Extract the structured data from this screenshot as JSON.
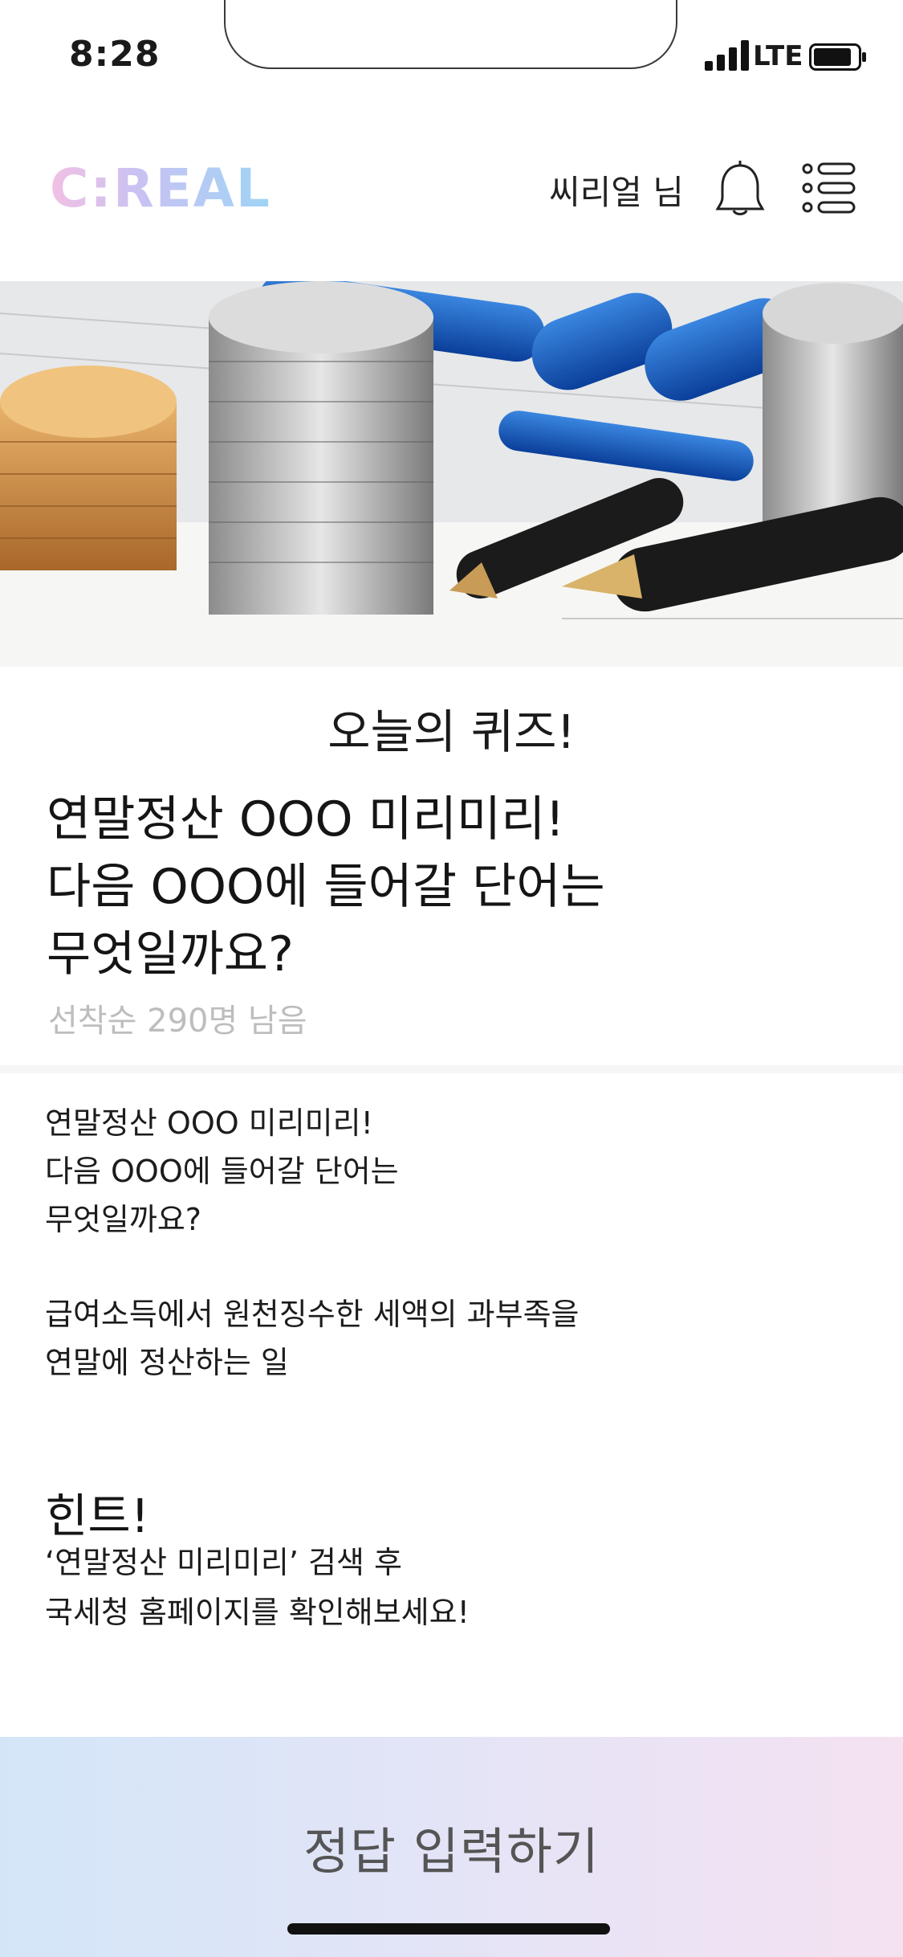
{
  "status_bar": {
    "time": "8:28",
    "network": "LTE",
    "battery_level": 0.8
  },
  "header": {
    "logo": "C:REAL",
    "user_name": "씨리얼 님",
    "bell_icon": "bell-icon",
    "menu_icon": "menu-list-icon"
  },
  "hero": {
    "image": "coins-and-pens-photo"
  },
  "quiz": {
    "label": "오늘의 퀴즈!",
    "question_lines": [
      "연말정산 OOO 미리미리!",
      "다음 OOO에 들어갈 단어는",
      "무엇일까요?"
    ],
    "remaining": "선착순 290명 남음"
  },
  "body": {
    "lines": [
      "연말정산 OOO 미리미리!",
      "다음 OOO에 들어갈 단어는",
      "무엇일까요?"
    ],
    "definition_lines": [
      "급여소득에서 원천징수한 세액의 과부족을",
      "연말에 정산하는 일"
    ]
  },
  "hint": {
    "title": "힌트!",
    "lines": [
      "‘연말정산 미리미리’ 검색 후",
      "국세청 홈페이지를 확인해보세요!"
    ]
  },
  "cta": {
    "label": "정답 입력하기"
  },
  "colors": {
    "logo_gradient_start": "#f2c0e4",
    "logo_gradient_end": "#9fd4f6",
    "cta_start": "#d3e6f8",
    "cta_end": "#f4e2f1",
    "muted_text": "#bdbdbd"
  }
}
